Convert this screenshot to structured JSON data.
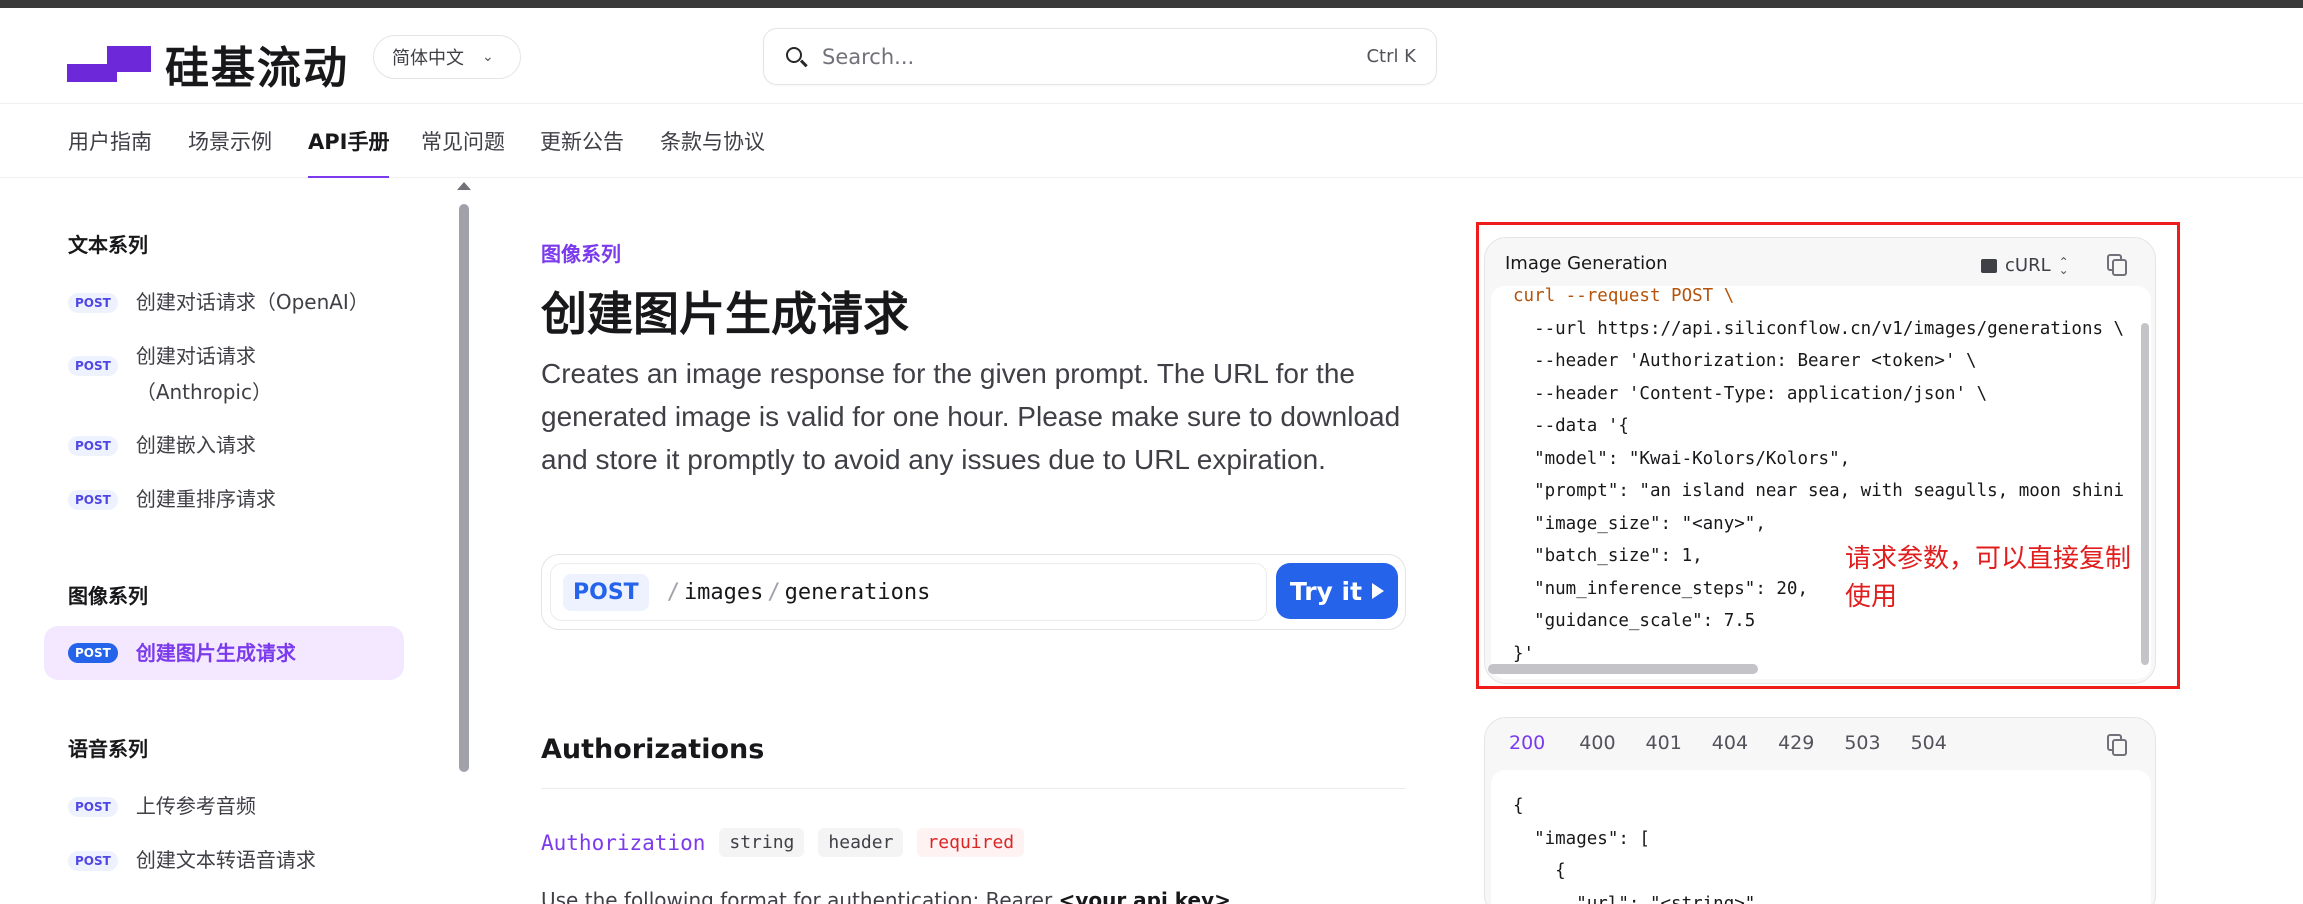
{
  "header": {
    "logo_text": "硅基流动",
    "language": "简体中文",
    "search_placeholder": "Search...",
    "search_shortcut": "Ctrl K"
  },
  "nav": {
    "tabs": [
      {
        "label": "用户指南"
      },
      {
        "label": "场景示例"
      },
      {
        "label": "API手册",
        "active": true
      },
      {
        "label": "常见问题"
      },
      {
        "label": "更新公告"
      },
      {
        "label": "条款与协议"
      }
    ]
  },
  "sidebar": {
    "groups": [
      {
        "heading": "文本系列",
        "items": [
          {
            "method": "POST",
            "label": "创建对话请求（OpenAI）"
          },
          {
            "method": "POST",
            "label_line1": "创建对话请求",
            "label_line2": "（Anthropic）"
          },
          {
            "method": "POST",
            "label": "创建嵌入请求"
          },
          {
            "method": "POST",
            "label": "创建重排序请求"
          }
        ]
      },
      {
        "heading": "图像系列",
        "items": [
          {
            "method": "POST",
            "label": "创建图片生成请求",
            "active": true
          }
        ]
      },
      {
        "heading": "语音系列",
        "items": [
          {
            "method": "POST",
            "label": "上传参考音频"
          },
          {
            "method": "POST",
            "label": "创建文本转语音请求"
          }
        ]
      }
    ]
  },
  "main": {
    "eyebrow": "图像系列",
    "title": "创建图片生成请求",
    "description": "Creates an image response for the given prompt. The URL for the generated image is valid for one hour. Please make sure to download and store it promptly to avoid any issues due to URL expiration.",
    "endpoint": {
      "method": "POST",
      "path_sep": "/",
      "path_parts": [
        "images",
        "generations"
      ],
      "try_label": "Try it"
    },
    "auth_section_title": "Authorizations",
    "param": {
      "name": "Authorization",
      "type": "string",
      "location": "header",
      "required": "required",
      "desc_prefix": "Use the following format for authentication: Bearer ",
      "desc_bold": "<your api key>"
    }
  },
  "code_panel": {
    "title": "Image Generation",
    "language": "cURL",
    "lines": {
      "l0": "curl --request POST \\",
      "l1": "  --url https://api.siliconflow.cn/v1/images/generations \\",
      "l2": "  --header 'Authorization: Bearer <token>' \\",
      "l3": "  --header 'Content-Type: application/json' \\",
      "l4": "  --data '{",
      "l5": "  \"model\": \"Kwai-Kolors/Kolors\",",
      "l6": "  \"prompt\": \"an island near sea, with seagulls, moon shini",
      "l7": "  \"image_size\": \"<any>\",",
      "l8": "  \"batch_size\": 1,",
      "l9": "  \"num_inference_steps\": 20,",
      "l10": "  \"guidance_scale\": 7.5",
      "l11": "}'"
    }
  },
  "annotation": {
    "text": "请求参数，可以直接复制使用",
    "color": "#e11d1d"
  },
  "response_panel": {
    "tabs": [
      "200",
      "400",
      "401",
      "404",
      "429",
      "503",
      "504"
    ],
    "active_tab": "200",
    "lines": {
      "l0": "{",
      "l1": "  \"images\": [",
      "l2": "    {",
      "l3": "      \"url\": \"<string>\""
    }
  },
  "colors": {
    "brand": "#6d28d9",
    "accent": "#7c3aed",
    "primary_button": "#2563eb",
    "required": "#dc2626"
  }
}
